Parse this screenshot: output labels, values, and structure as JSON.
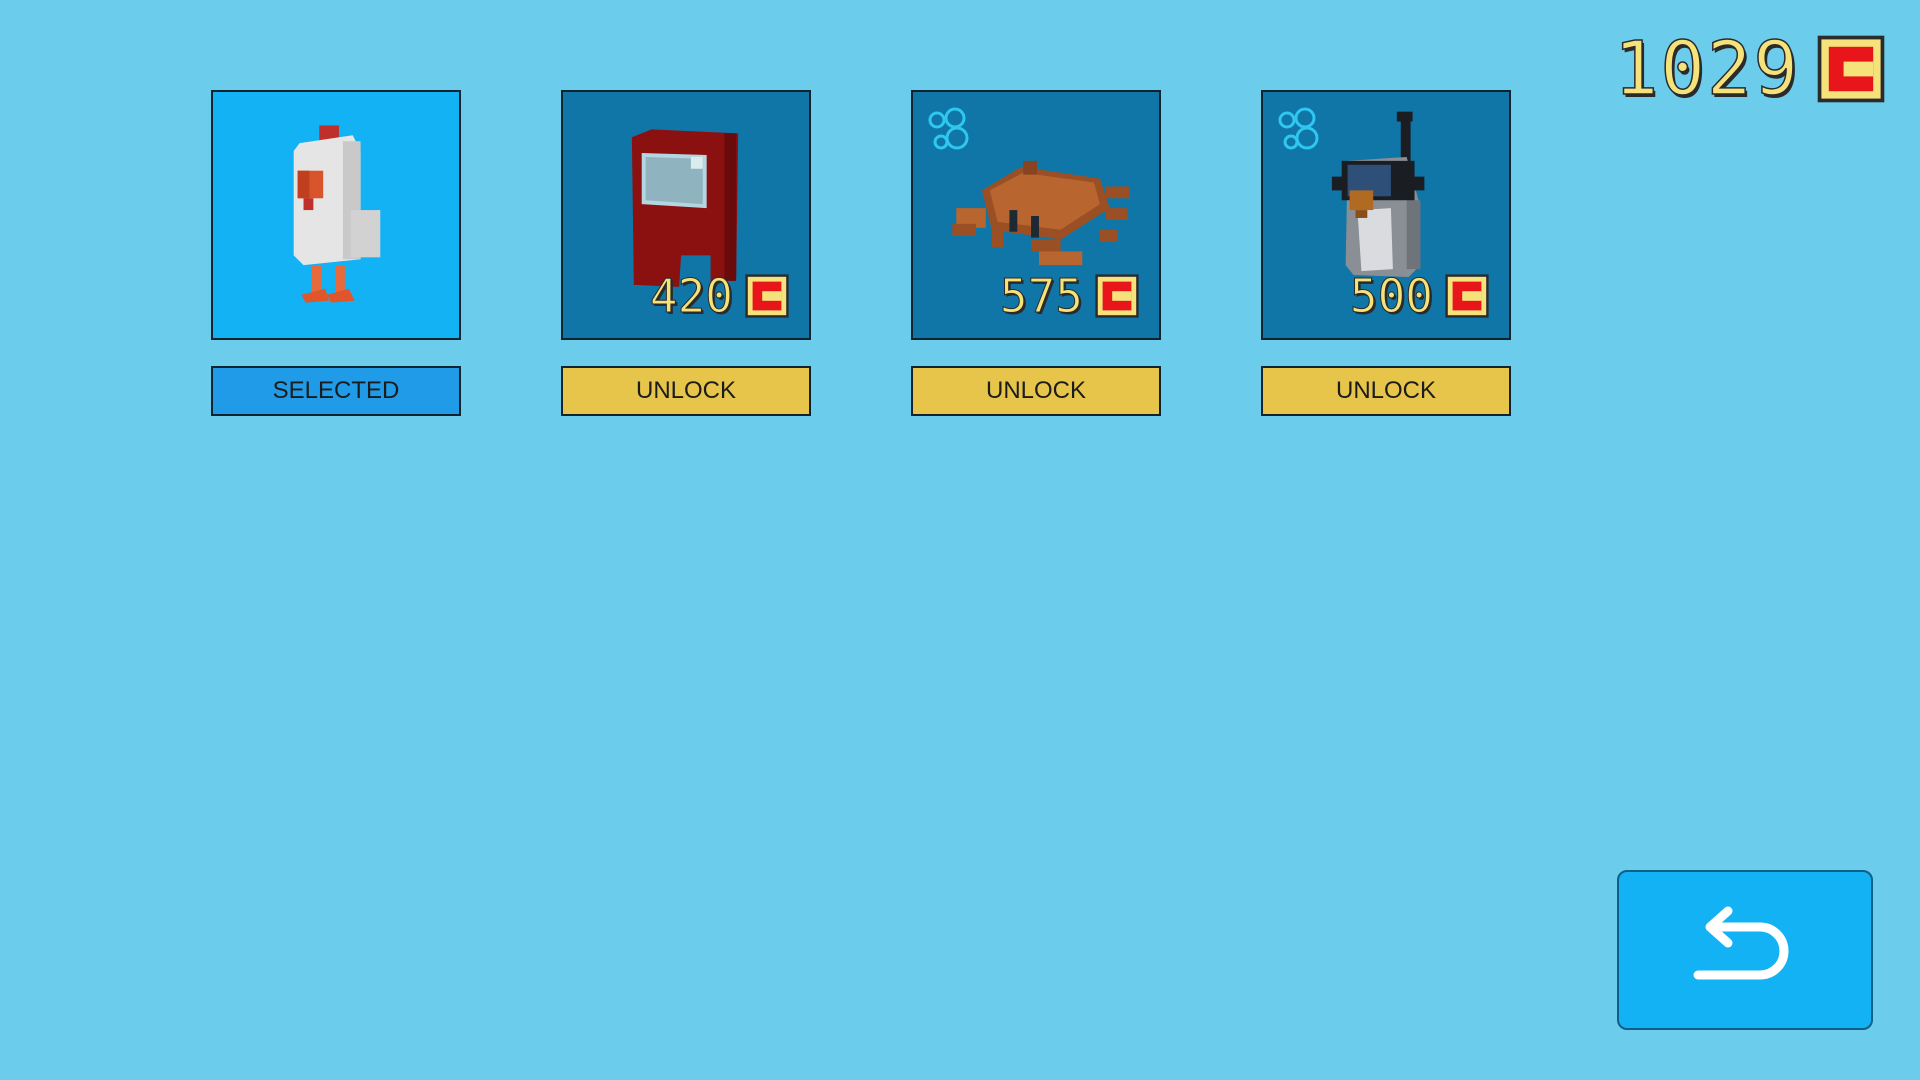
{
  "coins": {
    "count": "1029",
    "icon": "coin-icon"
  },
  "characters": [
    {
      "name": "chicken",
      "state": "selected",
      "price": null,
      "button_label": "SELECTED",
      "underwater": false
    },
    {
      "name": "red-crewmate",
      "state": "locked",
      "price": "420",
      "button_label": "UNLOCK",
      "underwater": false
    },
    {
      "name": "crab",
      "state": "locked",
      "price": "575",
      "button_label": "UNLOCK",
      "underwater": true
    },
    {
      "name": "penguin-diver",
      "state": "locked",
      "price": "500",
      "button_label": "UNLOCK",
      "underwater": true
    }
  ],
  "back_button": {
    "icon": "back-arrow-icon"
  },
  "colors": {
    "background": "#6bcdeb",
    "selected_card": "#12b2f5",
    "locked_card": "#0f76a7",
    "unlock_button": "#e6c54a",
    "selected_button": "#1f9be8",
    "coin_text": "#f6e27a",
    "coin_red": "#e8151b"
  }
}
